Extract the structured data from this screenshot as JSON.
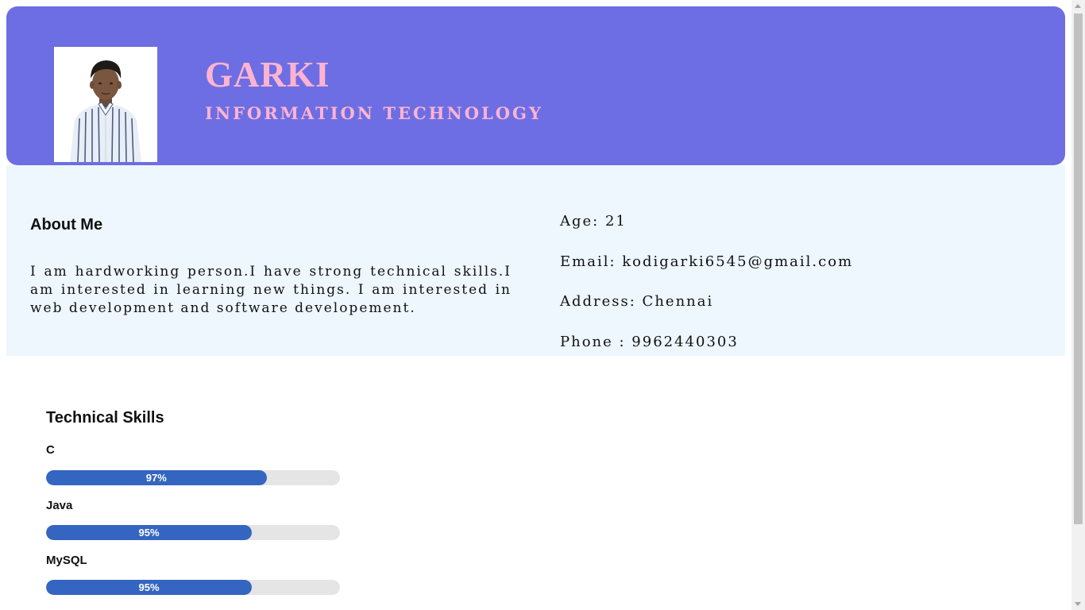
{
  "profile": {
    "name": "GARKI",
    "department": "INFORMATION TECHNOLOGY"
  },
  "about": {
    "title": "About Me",
    "text": "I am hardworking person.I have strong technical skills.I am interested in learning new things. I am interested in web development and software developement."
  },
  "contact": {
    "age": "Age: 21",
    "email": "Email: kodigarki6545@gmail.com",
    "address": "Address: Chennai",
    "phone": "Phone : 9962440303"
  },
  "skills": {
    "title": "Technical Skills",
    "items": [
      {
        "name": "C",
        "label": "97%",
        "level": 75
      },
      {
        "name": "Java",
        "label": "95%",
        "level": 70
      },
      {
        "name": "MySQL",
        "label": "95%",
        "level": 70
      }
    ]
  },
  "colors": {
    "header_bg": "#6d6ee3",
    "accent_text": "#ffb3d1",
    "info_bg": "#eef6fe",
    "bar_fill": "#3465c1",
    "bar_track": "#e5e5e5"
  },
  "icons": {
    "profile_photo": "person-photo",
    "scroll_up": "arrow-up-icon",
    "scroll_down": "arrow-down-icon"
  }
}
